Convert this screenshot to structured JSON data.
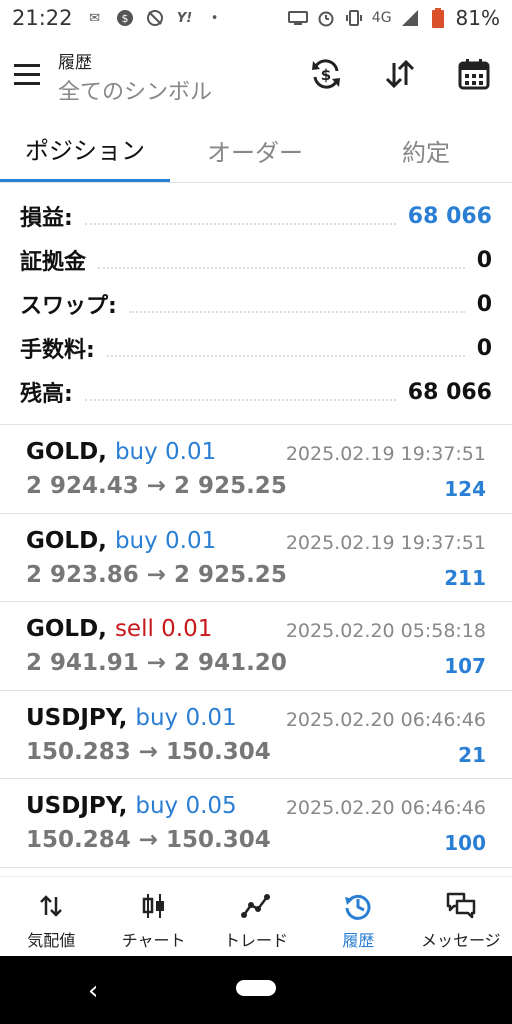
{
  "status": {
    "time": "21:22",
    "network": "4G",
    "battery": "81%"
  },
  "header": {
    "subtitle": "履歴",
    "title": "全てのシンボル",
    "icons": [
      "menu-icon",
      "currency-sync-icon",
      "sort-icon",
      "calendar-icon"
    ]
  },
  "tabs": [
    {
      "label": "ポジション",
      "active": true
    },
    {
      "label": "オーダー",
      "active": false
    },
    {
      "label": "約定",
      "active": false
    }
  ],
  "summary": [
    {
      "label": "損益:",
      "value": "68 066",
      "color": "#2a7fd4"
    },
    {
      "label": "証拠金",
      "value": "0"
    },
    {
      "label": "スワップ:",
      "value": "0"
    },
    {
      "label": "手数料:",
      "value": "0"
    },
    {
      "label": "残高:",
      "value": "68 066"
    }
  ],
  "trades": [
    {
      "symbol": "GOLD,",
      "side": "buy 0.01",
      "type": "buy",
      "prices": "2 924.43 → 2 925.25",
      "time": "2025.02.19 19:37:51",
      "profit": "124"
    },
    {
      "symbol": "GOLD,",
      "side": "buy 0.01",
      "type": "buy",
      "prices": "2 923.86 → 2 925.25",
      "time": "2025.02.19 19:37:51",
      "profit": "211"
    },
    {
      "symbol": "GOLD,",
      "side": "sell 0.01",
      "type": "sell",
      "prices": "2 941.91 → 2 941.20",
      "time": "2025.02.20 05:58:18",
      "profit": "107"
    },
    {
      "symbol": "USDJPY,",
      "side": "buy 0.01",
      "type": "buy",
      "prices": "150.283 → 150.304",
      "time": "2025.02.20 06:46:46",
      "profit": "21"
    },
    {
      "symbol": "USDJPY,",
      "side": "buy 0.05",
      "type": "buy",
      "prices": "150.284 → 150.304",
      "time": "2025.02.20 06:46:46",
      "profit": "100"
    }
  ],
  "bottom_nav": [
    {
      "label": "気配値",
      "icon": "quotes-icon",
      "active": false
    },
    {
      "label": "チャート",
      "icon": "candlestick-chart-icon",
      "active": false
    },
    {
      "label": "トレード",
      "icon": "trade-line-icon",
      "active": false
    },
    {
      "label": "履歴",
      "icon": "history-icon",
      "active": true
    },
    {
      "label": "メッセージ",
      "icon": "messages-icon",
      "active": false
    }
  ],
  "colors": {
    "accent": "#2a7fd4",
    "sell": "#c8191c",
    "muted": "#888888"
  }
}
